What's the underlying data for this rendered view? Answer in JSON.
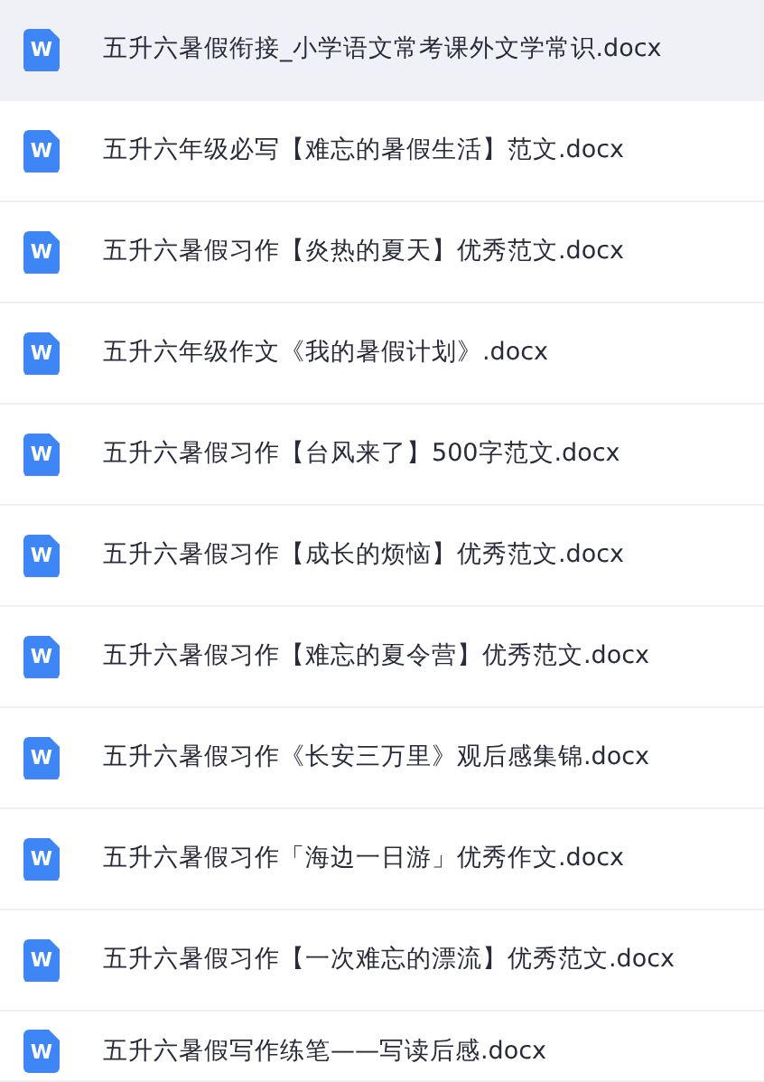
{
  "files": [
    {
      "name": "五升六暑假衔接_小学语文常考课外文学常识.docx",
      "icon_letter": "W",
      "selected": true
    },
    {
      "name": "五升六年级必写【难忘的暑假生活】范文.docx",
      "icon_letter": "W",
      "selected": false
    },
    {
      "name": "五升六暑假习作【炎热的夏天】优秀范文.docx",
      "icon_letter": "W",
      "selected": false
    },
    {
      "name": "五升六年级作文《我的暑假计划》.docx",
      "icon_letter": "W",
      "selected": false
    },
    {
      "name": "五升六暑假习作【台风来了】500字范文.docx",
      "icon_letter": "W",
      "selected": false
    },
    {
      "name": "五升六暑假习作【成长的烦恼】优秀范文.docx",
      "icon_letter": "W",
      "selected": false
    },
    {
      "name": "五升六暑假习作【难忘的夏令营】优秀范文.docx",
      "icon_letter": "W",
      "selected": false
    },
    {
      "name": "五升六暑假习作《长安三万里》观后感集锦.docx",
      "icon_letter": "W",
      "selected": false
    },
    {
      "name": "五升六暑假习作「海边一日游」优秀作文.docx",
      "icon_letter": "W",
      "selected": false
    },
    {
      "name": "五升六暑假习作【一次难忘的漂流】优秀范文.docx",
      "icon_letter": "W",
      "selected": false
    },
    {
      "name": "五升六暑假写作练笔——写读后感.docx",
      "icon_letter": "W",
      "selected": false
    }
  ]
}
